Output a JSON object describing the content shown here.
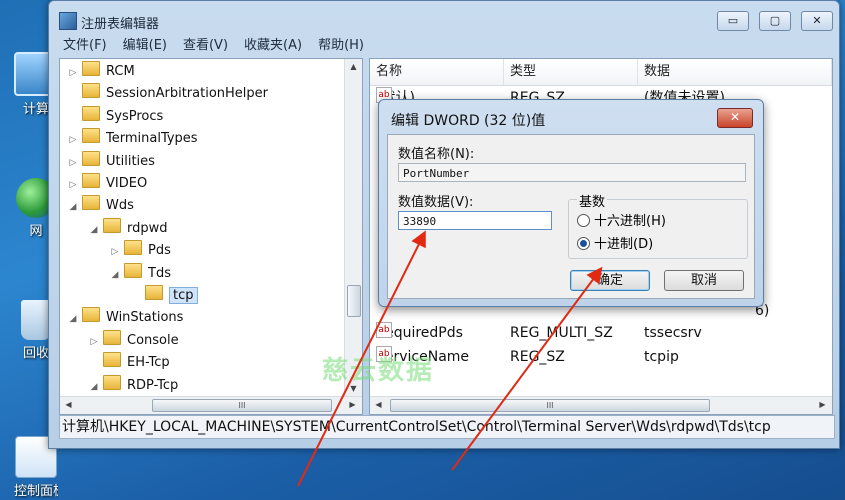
{
  "desktop": {
    "icons": [
      {
        "label": "计算"
      },
      {
        "label": "网"
      },
      {
        "label": "回收"
      },
      {
        "label": "控制面板"
      }
    ]
  },
  "window": {
    "title": "注册表编辑器",
    "controls": {
      "minimize": "▭",
      "maximize": "▢",
      "close": "✕"
    },
    "menu": [
      "文件(F)",
      "编辑(E)",
      "查看(V)",
      "收藏夹(A)",
      "帮助(H)"
    ]
  },
  "tree": {
    "items": [
      {
        "label": "RCM",
        "toggle": "▷"
      },
      {
        "label": "SessionArbitrationHelper",
        "toggle": ""
      },
      {
        "label": "SysProcs",
        "toggle": ""
      },
      {
        "label": "TerminalTypes",
        "toggle": "▷"
      },
      {
        "label": "Utilities",
        "toggle": "▷"
      },
      {
        "label": "VIDEO",
        "toggle": "▷"
      },
      {
        "label": "Wds",
        "toggle": "◢"
      },
      {
        "label": "rdpwd",
        "toggle": "◢"
      },
      {
        "label": "Pds",
        "toggle": "▷"
      },
      {
        "label": "Tds",
        "toggle": "◢"
      },
      {
        "label": "tcp",
        "toggle": "",
        "selected": true
      },
      {
        "label": "WinStations",
        "toggle": "◢"
      },
      {
        "label": "Console",
        "toggle": "▷"
      },
      {
        "label": "EH-Tcp",
        "toggle": ""
      },
      {
        "label": "RDP-Tcp",
        "toggle": "◢"
      }
    ],
    "hscroll_grip": "III"
  },
  "list": {
    "columns": [
      "名称",
      "类型",
      "数据"
    ],
    "rows": [
      {
        "icon": "ab",
        "name": "(默认)",
        "type": "REG_SZ",
        "data": "(数值未设置)"
      },
      {
        "icon": "ab",
        "name": "RequiredPds",
        "type": "REG_MULTI_SZ",
        "data": "tssecsrv"
      },
      {
        "icon": "ab",
        "name": "ServiceName",
        "type": "REG_SZ",
        "data": "tcpip"
      }
    ],
    "partial_data": "6)",
    "hscroll_grip": "III"
  },
  "status_path": "计算机\\HKEY_LOCAL_MACHINE\\SYSTEM\\CurrentControlSet\\Control\\Terminal Server\\Wds\\rdpwd\\Tds\\tcp",
  "dialog": {
    "title": "编辑 DWORD (32 位)值",
    "close": "✕",
    "value_name_label": "数值名称(N):",
    "value_name": "PortNumber",
    "value_data_label": "数值数据(V):",
    "value_data": "33890",
    "base_label": "基数",
    "base_options": [
      {
        "label": "十六进制(H)",
        "selected": false
      },
      {
        "label": "十进制(D)",
        "selected": true
      }
    ],
    "ok": "确定",
    "cancel": "取消"
  },
  "watermark": "慈云数据",
  "colors": {
    "arrow": "#e02a12",
    "selection": "#cfe3fa"
  }
}
